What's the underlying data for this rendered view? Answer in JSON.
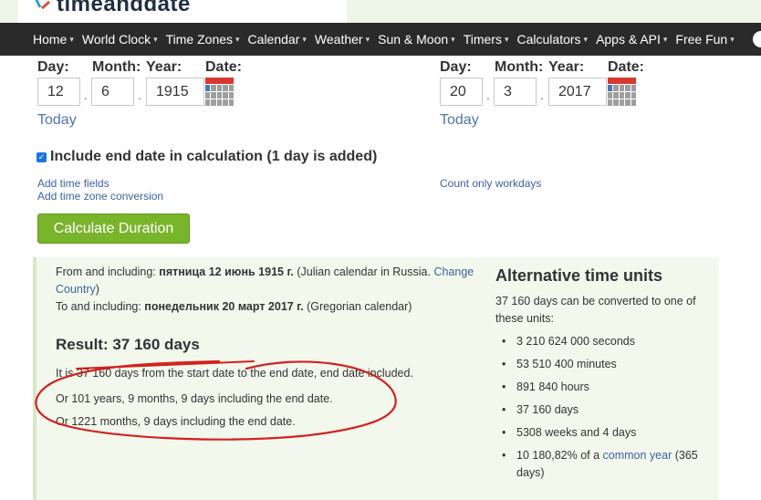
{
  "header": {
    "logo_text": "timeanddate"
  },
  "nav": {
    "items": [
      {
        "label": "Home"
      },
      {
        "label": "World Clock"
      },
      {
        "label": "Time Zones"
      },
      {
        "label": "Calendar"
      },
      {
        "label": "Weather"
      },
      {
        "label": "Sun & Moon"
      },
      {
        "label": "Timers"
      },
      {
        "label": "Calculators"
      },
      {
        "label": "Apps & API"
      },
      {
        "label": "Free Fun"
      }
    ]
  },
  "start": {
    "day_label": "Day:",
    "month_label": "Month:",
    "year_label": "Year:",
    "date_label": "Date:",
    "day": "12",
    "month": "6",
    "year": "1915",
    "today": "Today"
  },
  "end": {
    "day_label": "Day:",
    "month_label": "Month:",
    "year_label": "Year:",
    "date_label": "Date:",
    "day": "20",
    "month": "3",
    "year": "2017",
    "today": "Today"
  },
  "options": {
    "include_end": "Include end date in calculation (1 day is added)",
    "add_time_fields": "Add time fields",
    "add_timezone": "Add time zone conversion",
    "count_workdays": "Count only workdays"
  },
  "calculate_button": "Calculate Duration",
  "result": {
    "from_prefix": "From and including: ",
    "from_date": "пятница 12 июнь 1915 г.",
    "from_suffix": " (Julian calendar in Russia. ",
    "from_link": "Change Country",
    "from_end": ")",
    "to_prefix": "To and including: ",
    "to_date": "понедельник 20 март 2017 г.",
    "to_suffix": " (Gregorian calendar)",
    "headline": "Result: 37 160 days",
    "line1": "It is 37 160 days from the start date to the end date, end date included.",
    "line2": "Or 101 years, 9 months, 9 days including the end date.",
    "line3": "Or 1221 months, 9 days including the end date."
  },
  "alternative": {
    "title": "Alternative time units",
    "description": "37 160 days can be converted to one of these units:",
    "items": [
      "3 210 624 000 seconds",
      "53 510 400 minutes",
      "891 840 hours",
      "37 160 days",
      "5308 weeks and 4 days"
    ],
    "last_prefix": "10 180,82% of a ",
    "last_link": "common year",
    "last_suffix": " (365 days)"
  },
  "colors": {
    "nav_bg": "#2a2a2a",
    "button_green": "#79b52b",
    "panel_bg": "#f2f9ec",
    "link_blue": "#3c61a8",
    "annotation_red": "#d42020"
  }
}
